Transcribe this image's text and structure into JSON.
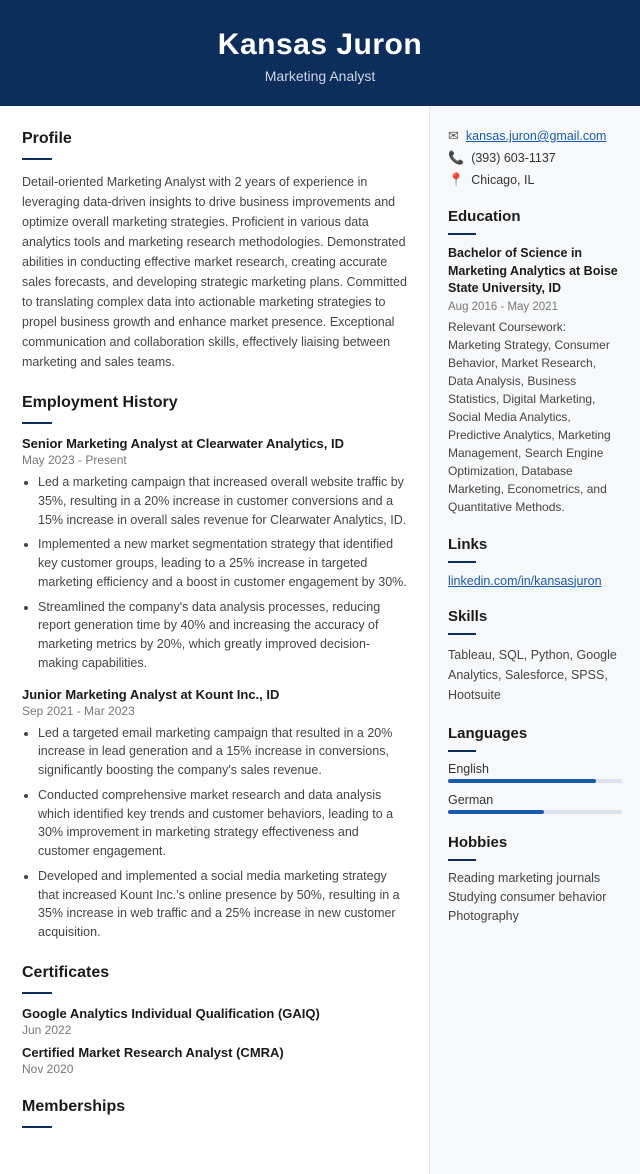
{
  "header": {
    "name": "Kansas Juron",
    "title": "Marketing Analyst"
  },
  "contact": {
    "email": "kansas.juron@gmail.com",
    "phone": "(393) 603-1137",
    "location": "Chicago, IL"
  },
  "profile": {
    "section_title": "Profile",
    "text": "Detail-oriented Marketing Analyst with 2 years of experience in leveraging data-driven insights to drive business improvements and optimize overall marketing strategies. Proficient in various data analytics tools and marketing research methodologies. Demonstrated abilities in conducting effective market research, creating accurate sales forecasts, and developing strategic marketing plans. Committed to translating complex data into actionable marketing strategies to propel business growth and enhance market presence. Exceptional communication and collaboration skills, effectively liaising between marketing and sales teams."
  },
  "employment": {
    "section_title": "Employment History",
    "jobs": [
      {
        "title": "Senior Marketing Analyst at Clearwater Analytics, ID",
        "date": "May 2023 - Present",
        "bullets": [
          "Led a marketing campaign that increased overall website traffic by 35%, resulting in a 20% increase in customer conversions and a 15% increase in overall sales revenue for Clearwater Analytics, ID.",
          "Implemented a new market segmentation strategy that identified key customer groups, leading to a 25% increase in targeted marketing efficiency and a boost in customer engagement by 30%.",
          "Streamlined the company's data analysis processes, reducing report generation time by 40% and increasing the accuracy of marketing metrics by 20%, which greatly improved decision-making capabilities."
        ]
      },
      {
        "title": "Junior Marketing Analyst at Kount Inc., ID",
        "date": "Sep 2021 - Mar 2023",
        "bullets": [
          "Led a targeted email marketing campaign that resulted in a 20% increase in lead generation and a 15% increase in conversions, significantly boosting the company's sales revenue.",
          "Conducted comprehensive market research and data analysis which identified key trends and customer behaviors, leading to a 30% improvement in marketing strategy effectiveness and customer engagement.",
          "Developed and implemented a social media marketing strategy that increased Kount Inc.'s online presence by 50%, resulting in a 35% increase in web traffic and a 25% increase in new customer acquisition."
        ]
      }
    ]
  },
  "certificates": {
    "section_title": "Certificates",
    "items": [
      {
        "title": "Google Analytics Individual Qualification (GAIQ)",
        "date": "Jun 2022"
      },
      {
        "title": "Certified Market Research Analyst (CMRA)",
        "date": "Nov 2020"
      }
    ]
  },
  "memberships": {
    "section_title": "Memberships"
  },
  "education": {
    "section_title": "Education",
    "degree": "Bachelor of Science in Marketing Analytics at Boise State University, ID",
    "date": "Aug 2016 - May 2021",
    "courses": "Relevant Coursework: Marketing Strategy, Consumer Behavior, Market Research, Data Analysis, Business Statistics, Digital Marketing, Social Media Analytics, Predictive Analytics, Marketing Management, Search Engine Optimization, Database Marketing, Econometrics, and Quantitative Methods."
  },
  "links": {
    "section_title": "Links",
    "items": [
      {
        "text": "linkedin.com/in/kansasjuron",
        "url": "#"
      }
    ]
  },
  "skills": {
    "section_title": "Skills",
    "text": "Tableau, SQL, Python, Google Analytics, Salesforce, SPSS, Hootsuite"
  },
  "languages": {
    "section_title": "Languages",
    "items": [
      {
        "name": "English",
        "level": 85
      },
      {
        "name": "German",
        "level": 55
      }
    ]
  },
  "hobbies": {
    "section_title": "Hobbies",
    "items": [
      "Reading marketing journals",
      "Studying consumer behavior",
      "Photography"
    ]
  }
}
